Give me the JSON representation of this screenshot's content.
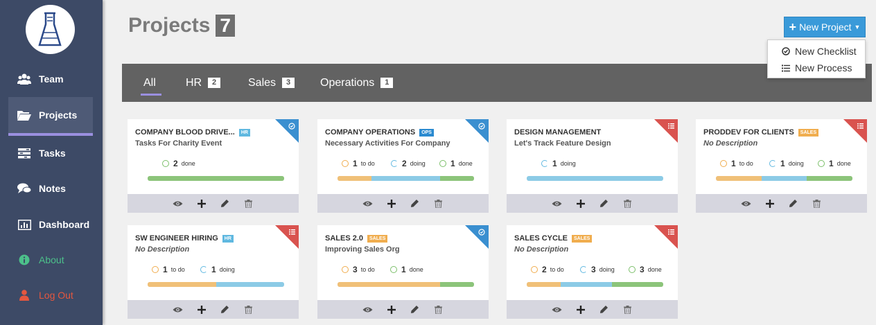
{
  "sidebar": {
    "items": [
      {
        "label": "Team",
        "icon": "team-icon"
      },
      {
        "label": "Projects",
        "icon": "folder-icon",
        "active": true
      },
      {
        "label": "Tasks",
        "icon": "tasks-icon"
      },
      {
        "label": "Notes",
        "icon": "notes-icon"
      },
      {
        "label": "Dashboard",
        "icon": "dashboard-icon"
      },
      {
        "label": "About",
        "icon": "info-icon"
      },
      {
        "label": "Log Out",
        "icon": "user-icon"
      }
    ]
  },
  "header": {
    "title": "Projects",
    "count": "7",
    "new_project_label": "New Project",
    "dropdown": [
      {
        "label": "New Checklist",
        "icon": "check-circle-icon"
      },
      {
        "label": "New Process",
        "icon": "list-icon"
      }
    ]
  },
  "filters": [
    {
      "label": "All",
      "count": ""
    },
    {
      "label": "HR",
      "count": "2"
    },
    {
      "label": "Sales",
      "count": "3"
    },
    {
      "label": "Operations",
      "count": "1"
    }
  ],
  "colors": {
    "sidebar_bg": "#3d4a66",
    "accent": "#9a8fe0",
    "button_blue": "#3a9ad9",
    "todo": "#f0ad4e",
    "doing": "#5fb8e0",
    "done": "#7cc06a",
    "corner_checklist": "#3a8fd0",
    "corner_process": "#d9534f"
  },
  "projects": [
    {
      "title": "COMPANY BLOOD DRIVE...",
      "tag": "HR",
      "subtitle": "Tasks For Charity Event",
      "corner": "checklist",
      "stats": [
        {
          "n": "2",
          "label": "done"
        }
      ]
    },
    {
      "title": "COMPANY OPERATIONS",
      "tag": "OPS",
      "subtitle": "Necessary Activities For Company",
      "corner": "checklist",
      "stats": [
        {
          "n": "1",
          "label": "to do"
        },
        {
          "n": "2",
          "label": "doing"
        },
        {
          "n": "1",
          "label": "done"
        }
      ]
    },
    {
      "title": "DESIGN MANAGEMENT",
      "tag": "",
      "subtitle": "Let's Track Feature Design",
      "corner": "process",
      "stats": [
        {
          "n": "1",
          "label": "doing"
        }
      ]
    },
    {
      "title": "PRODDEV FOR CLIENTS",
      "tag": "SALES",
      "subtitle": "No Description",
      "corner": "process",
      "stats": [
        {
          "n": "1",
          "label": "to do"
        },
        {
          "n": "1",
          "label": "doing"
        },
        {
          "n": "1",
          "label": "done"
        }
      ]
    },
    {
      "title": "SW ENGINEER HIRING",
      "tag": "HR",
      "subtitle": "No Description",
      "corner": "process",
      "stats": [
        {
          "n": "1",
          "label": "to do"
        },
        {
          "n": "1",
          "label": "doing"
        }
      ]
    },
    {
      "title": "SALES 2.0",
      "tag": "SALES",
      "subtitle": "Improving Sales Org",
      "corner": "checklist",
      "stats": [
        {
          "n": "3",
          "label": "to do"
        },
        {
          "n": "1",
          "label": "done"
        }
      ]
    },
    {
      "title": "SALES CYCLE",
      "tag": "SALES",
      "subtitle": "No Description",
      "corner": "process",
      "stats": [
        {
          "n": "2",
          "label": "to do"
        },
        {
          "n": "3",
          "label": "doing"
        },
        {
          "n": "3",
          "label": "done"
        }
      ]
    }
  ]
}
